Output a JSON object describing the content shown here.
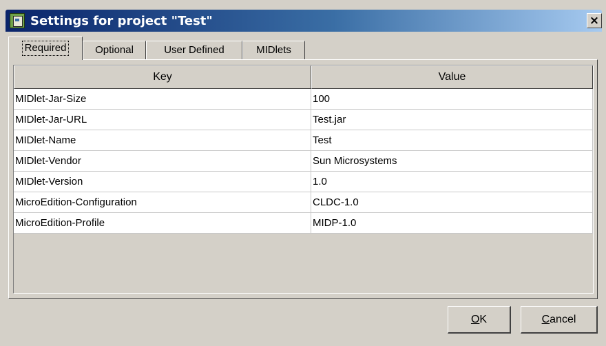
{
  "window": {
    "title": "Settings for project \"Test\"",
    "close_glyph": "×"
  },
  "tabs": [
    {
      "label": "Required",
      "active": true
    },
    {
      "label": "Optional",
      "active": false
    },
    {
      "label": "User Defined",
      "active": false
    },
    {
      "label": "MIDlets",
      "active": false
    }
  ],
  "table": {
    "columns": [
      "Key",
      "Value"
    ],
    "rows": [
      {
        "key": "MIDlet-Jar-Size",
        "value": "100"
      },
      {
        "key": "MIDlet-Jar-URL",
        "value": "Test.jar"
      },
      {
        "key": "MIDlet-Name",
        "value": "Test"
      },
      {
        "key": "MIDlet-Vendor",
        "value": "Sun Microsystems"
      },
      {
        "key": "MIDlet-Version",
        "value": "1.0"
      },
      {
        "key": "MicroEdition-Configuration",
        "value": "CLDC-1.0"
      },
      {
        "key": "MicroEdition-Profile",
        "value": "MIDP-1.0"
      }
    ]
  },
  "buttons": {
    "ok": {
      "mnemonic": "O",
      "rest": "K"
    },
    "cancel": {
      "mnemonic": "C",
      "rest": "ancel"
    }
  },
  "colors": {
    "title_start": "#0a246a",
    "title_end": "#a6caf0",
    "face": "#d4d0c8"
  }
}
